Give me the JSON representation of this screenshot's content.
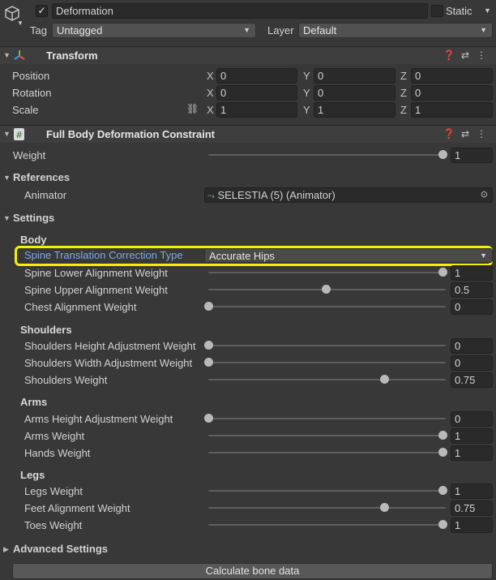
{
  "header": {
    "object_name": "Deformation",
    "static_label": "Static",
    "tag_label": "Tag",
    "tag_value": "Untagged",
    "layer_label": "Layer",
    "layer_value": "Default"
  },
  "transform": {
    "title": "Transform",
    "rows": [
      {
        "label": "Position",
        "x": "0",
        "y": "0",
        "z": "0"
      },
      {
        "label": "Rotation",
        "x": "0",
        "y": "0",
        "z": "0"
      },
      {
        "label": "Scale",
        "x": "1",
        "y": "1",
        "z": "1"
      }
    ],
    "axis_labels": [
      "X",
      "Y",
      "Z"
    ]
  },
  "constraint": {
    "title": "Full Body Deformation Constraint",
    "weight_label": "Weight",
    "weight_value": "1",
    "weight_level": 1,
    "references_label": "References",
    "animator_label": "Animator",
    "animator_value": "SELESTIA (5) (Animator)",
    "settings_label": "Settings",
    "body_label": "Body",
    "spine_type_label": "Spine Translation Correction Type",
    "spine_type_value": "Accurate Hips",
    "groups": [
      {
        "name": "Body",
        "rows": [
          {
            "label": "Spine Lower Alignment Weight",
            "value": "1",
            "level": 1
          },
          {
            "label": "Spine Upper Alignment Weight",
            "value": "0.5",
            "level": 0.5
          },
          {
            "label": "Chest Alignment Weight",
            "value": "0",
            "level": 0
          }
        ]
      },
      {
        "name": "Shoulders",
        "rows": [
          {
            "label": "Shoulders Height Adjustment Weight",
            "value": "0",
            "level": 0
          },
          {
            "label": "Shoulders Width Adjustment Weight",
            "value": "0",
            "level": 0
          },
          {
            "label": "Shoulders Weight",
            "value": "0.75",
            "level": 0.75
          }
        ]
      },
      {
        "name": "Arms",
        "rows": [
          {
            "label": "Arms Height Adjustment Weight",
            "value": "0",
            "level": 0
          },
          {
            "label": "Arms Weight",
            "value": "1",
            "level": 1
          },
          {
            "label": "Hands Weight",
            "value": "1",
            "level": 1
          }
        ]
      },
      {
        "name": "Legs",
        "rows": [
          {
            "label": "Legs Weight",
            "value": "1",
            "level": 1
          },
          {
            "label": "Feet Alignment Weight",
            "value": "0.75",
            "level": 0.75
          },
          {
            "label": "Toes Weight",
            "value": "1",
            "level": 1
          }
        ]
      }
    ],
    "advanced_label": "Advanced Settings",
    "calculate_button": "Calculate bone data"
  },
  "colors": {
    "background": "#383838",
    "highlight_outline": "#f5f000",
    "selected_label": "#7fa8e6"
  }
}
